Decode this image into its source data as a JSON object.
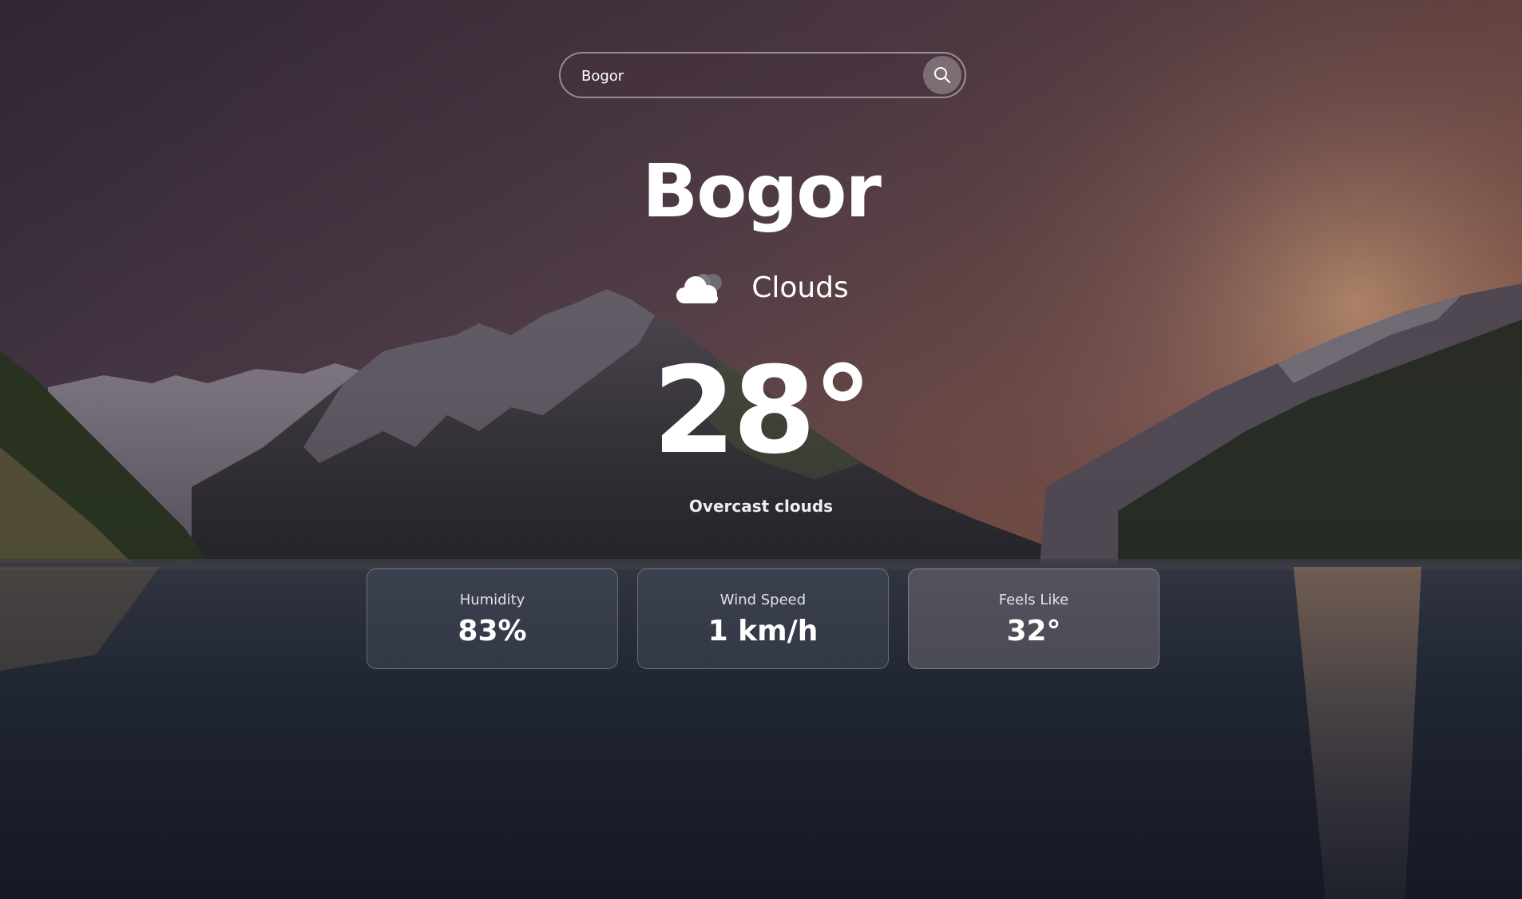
{
  "search": {
    "value": "Bogor",
    "placeholder": "",
    "icon": "search-icon"
  },
  "weather": {
    "city": "Bogor",
    "condition": "Clouds",
    "condition_icon": "cloud-icon",
    "temperature": "28°",
    "description": "Overcast clouds"
  },
  "stats": [
    {
      "label": "Humidity",
      "value": "83%"
    },
    {
      "label": "Wind Speed",
      "value": "1 km/h"
    },
    {
      "label": "Feels Like",
      "value": "32°"
    }
  ],
  "colors": {
    "sky_top": "#3a2f3a",
    "sunset_glow": "#c8754a",
    "water": "#1e2432"
  }
}
